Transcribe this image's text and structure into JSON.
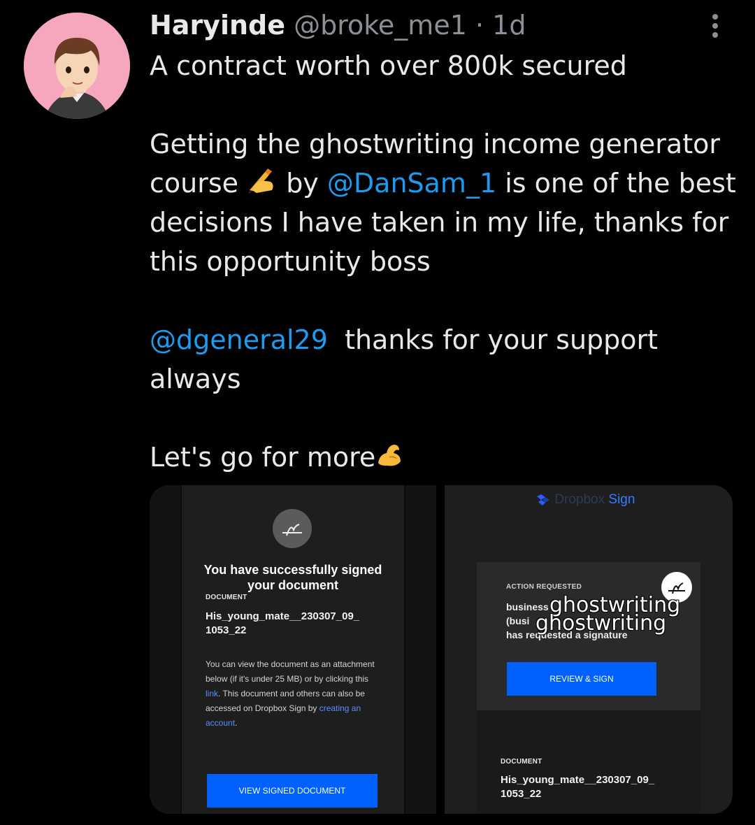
{
  "tweet": {
    "author_name": "Haryinde",
    "author_handle": "@broke_me1",
    "separator": "·",
    "age": "1d",
    "lines": {
      "l1": "A contract worth over 800k secured",
      "l2": "Getting the ghostwriting income generator",
      "l3a": "course ",
      "l3b": " by ",
      "l3mention": "@DanSam_1",
      "l3c": " is one of the best",
      "l4": "decisions I have taken in my life, thanks for",
      "l5": "this opportunity boss",
      "l6mention": "@dgeneral29",
      "l6b": "  thanks for your support",
      "l7": "always",
      "l8": "Let's go for more"
    },
    "emoji_writing": "writing-hand-icon",
    "emoji_muscle": "flexed-biceps-icon"
  },
  "media": {
    "left": {
      "title": "You have successfully signed your document",
      "doc_label": "DOCUMENT",
      "doc_name_1": "His_young_mate__230307_09_",
      "doc_name_2": "1053_22",
      "body_1": "You can view the document as an attachment below (if it's under 25 MB) or by clicking this ",
      "body_link1": "link",
      "body_2": ". This document and others can also be accessed on Dropbox Sign by ",
      "body_link2": "creating an account",
      "body_3": ".",
      "button": "VIEW SIGNED DOCUMENT"
    },
    "right": {
      "brand_muted": "Dropbox ",
      "brand_sign": "Sign",
      "action_label": "ACTION REQUESTED",
      "req_1": "business",
      "req_2": "(busi",
      "req_3": "has requested a signature",
      "overlay_word_1": "ghostwriting",
      "overlay_word_2": "ghostwriting",
      "button": "REVIEW & SIGN",
      "doc_label": "DOCUMENT",
      "doc_name_1": "His_young_mate__230307_09_",
      "doc_name_2": "1053_22"
    }
  },
  "colors": {
    "background": "#000000",
    "mention": "#1d9bf0",
    "muted": "#8b9096",
    "avatar_bg": "#f6a6bd",
    "dropbox_blue": "#0061fe"
  }
}
